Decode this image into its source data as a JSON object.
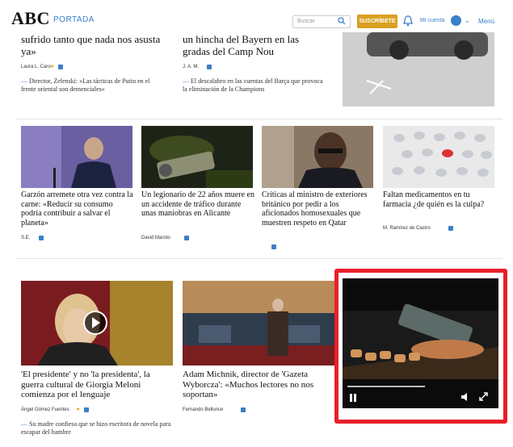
{
  "header": {
    "logo": "ABC",
    "section": "PORTADA",
    "search_placeholder": "Buscar",
    "subscribe": "SUSCRÍBETE",
    "login": "Mi cuenta",
    "menu": "Menú"
  },
  "top_left": {
    "headline": "sufrido tanto que nada nos asusta ya»",
    "author": "Laura L. Caro",
    "related": "Director, Zelenski: «Las tácticas de Putin en el frente oriental son demenciales»"
  },
  "top_mid": {
    "headline": "un hincha del Bayern en las gradas del Camp Nou",
    "author": "J. A. M.",
    "related": "El descalabro en las cuentas del Barça que provoca la eliminación de la Champions"
  },
  "row2": [
    {
      "headline": "Garzón arremete otra vez contra la carne: «Reducir su consumo podría contribuir a salvar el planeta»",
      "author": "S.E."
    },
    {
      "headline": "Un legionario de 22 años muere en un accidente de tráfico durante unas maniobras en Alicante",
      "author": "David Maroto"
    },
    {
      "headline": "Críticas al ministro de exteriores británico por pedir a los aficionados homosexuales que muestren respeto en Qatar",
      "author": ""
    },
    {
      "headline": "Faltan medicamentos en tu farmacia ¿de quién es la culpa?",
      "author": "M. Ramírez de Castro"
    }
  ],
  "row3": [
    {
      "headline": "'El presidente' y no 'la presidenta', la guerra cultural de Giorgia Meloni comienza por el lenguaje",
      "author": "Ángel Gómez Fuentes",
      "related": "Su madre confiesa que se hizo escritora de novela para escapar del hambre"
    },
    {
      "headline": "Adam Michnik, director de 'Gazeta Wyborcza': «Muchos lectores no nos soportan»",
      "author": "Fernando Bellunce"
    }
  ],
  "colors": {
    "accent": "#3b7fc9",
    "subscribe": "#d9a021",
    "highlight": "#e8202a"
  }
}
